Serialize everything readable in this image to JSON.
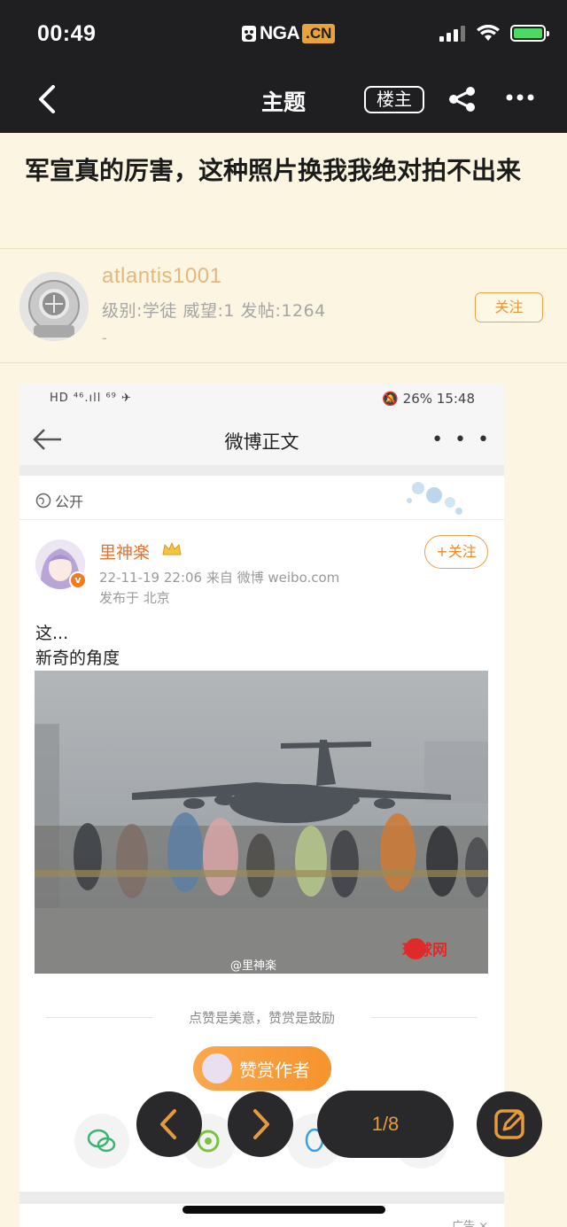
{
  "status": {
    "time": "00:49",
    "logo_text": "NGA",
    "logo_cn": ".CN"
  },
  "nav": {
    "title": "主题",
    "louzhu": "楼主"
  },
  "post": {
    "title": "军宣真的厉害，这种照片换我我绝对拍不出来"
  },
  "author": {
    "name": "atlantis1001",
    "meta": "级别:学徒  威望:1  发帖:1264",
    "signature": "-",
    "follow": "关注"
  },
  "screenshot": {
    "status_left": "HD ⁴⁶.ıll ⁶⁹ ✈",
    "status_right": "🔕 26% 15:48",
    "nav_title": "微博正文",
    "visibility": "公开",
    "weibo_user": "里神楽",
    "weibo_meta": "22-11-19 22:06  来自 微博 weibo.com",
    "weibo_location": "发布于 北京",
    "weibo_follow": "+关注",
    "text_line1": "这...",
    "text_line2": "新奇的角度",
    "watermark_weibo": "@里神楽",
    "watermark_hq": "环球网",
    "encourage": "点赞是美意，赞赏是鼓励",
    "reward": "赞赏作者",
    "ad": "广告 ×"
  },
  "pager": {
    "text": "1/8"
  },
  "colors": {
    "accent": "#e39b3c",
    "bar": "#1f1f21",
    "bg": "#fbf5e2",
    "author": "#e4b77f"
  }
}
